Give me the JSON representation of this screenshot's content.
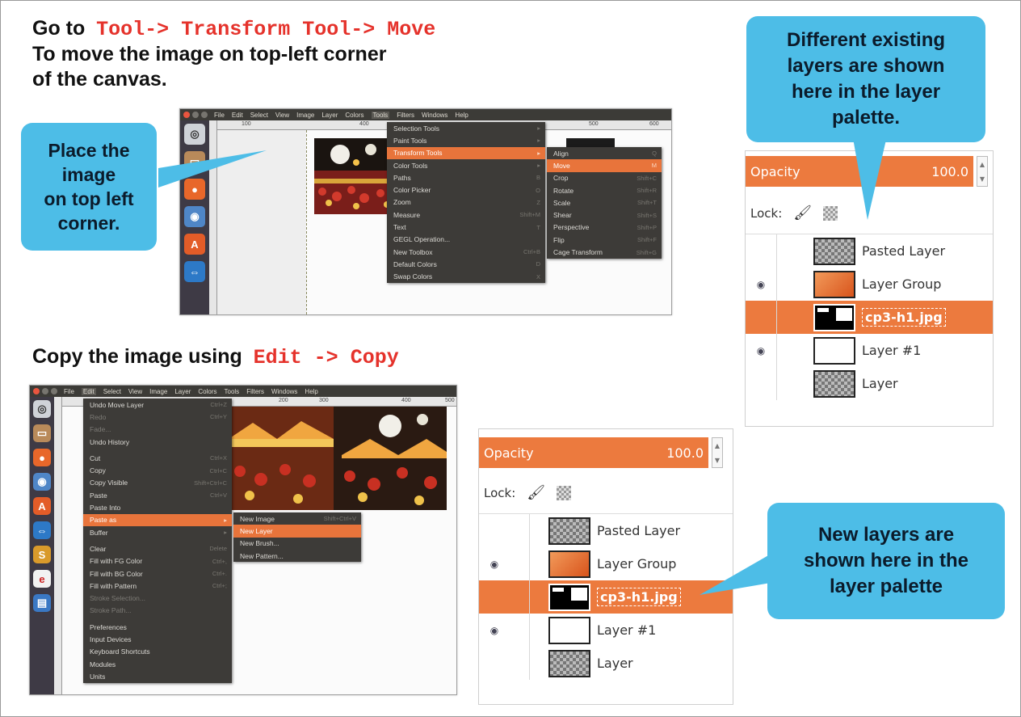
{
  "top_instruction": {
    "go_to": "Go to",
    "menu_path": "Tool-> Transform Tool-> Move",
    "line2": "To move the image on top-left corner",
    "line3": "of the canvas."
  },
  "copy_instruction": {
    "text": "Copy the image using",
    "menu_path": "Edit -> Copy"
  },
  "callouts": {
    "place": "Place the\nimage\non top left\ncorner.",
    "existing_layers": "Different existing\nlayers are shown\nhere in the layer\npalette.",
    "new_layers": "New layers are\nshown here in the\nlayer palette"
  },
  "gimp_menubar": [
    "File",
    "Edit",
    "Select",
    "View",
    "Image",
    "Layer",
    "Colors",
    "Tools",
    "Filters",
    "Windows",
    "Help"
  ],
  "ruler_top1": [
    "100",
    "400",
    "500",
    "600"
  ],
  "ruler_top2": [
    "200",
    "300",
    "400",
    "500"
  ],
  "tools_menu": [
    {
      "label": "Selection Tools",
      "sc": "▸"
    },
    {
      "label": "Paint Tools",
      "sc": "▸"
    },
    {
      "label": "Transform Tools",
      "sc": "▸",
      "sel": true
    },
    {
      "label": "Color Tools",
      "sc": "▸"
    },
    {
      "label": "Paths",
      "sc": "B"
    },
    {
      "label": "Color Picker",
      "sc": "O"
    },
    {
      "label": "Zoom",
      "sc": "Z"
    },
    {
      "label": "Measure",
      "sc": "Shift+M"
    },
    {
      "label": "Text",
      "sc": "T"
    },
    {
      "label": "GEGL Operation...",
      "sc": ""
    },
    {
      "label": "New Toolbox",
      "sc": "Ctrl+B"
    },
    {
      "label": "Default Colors",
      "sc": "D"
    },
    {
      "label": "Swap Colors",
      "sc": "X"
    }
  ],
  "transform_menu": [
    {
      "label": "Align",
      "sc": "Q"
    },
    {
      "label": "Move",
      "sc": "M",
      "sel": true
    },
    {
      "label": "Crop",
      "sc": "Shift+C"
    },
    {
      "label": "Rotate",
      "sc": "Shift+R"
    },
    {
      "label": "Scale",
      "sc": "Shift+T"
    },
    {
      "label": "Shear",
      "sc": "Shift+S"
    },
    {
      "label": "Perspective",
      "sc": "Shift+P"
    },
    {
      "label": "Flip",
      "sc": "Shift+F"
    },
    {
      "label": "Cage Transform",
      "sc": "Shift+G"
    }
  ],
  "edit_menu": [
    {
      "label": "Undo Move Layer",
      "sc": "Ctrl+Z"
    },
    {
      "label": "Redo",
      "sc": "Ctrl+Y",
      "dim": true
    },
    {
      "label": "Fade...",
      "sc": "",
      "dim": true
    },
    {
      "label": "Undo History",
      "sc": ""
    },
    {
      "sep": true
    },
    {
      "label": "Cut",
      "sc": "Ctrl+X"
    },
    {
      "label": "Copy",
      "sc": "Ctrl+C"
    },
    {
      "label": "Copy Visible",
      "sc": "Shift+Ctrl+C"
    },
    {
      "label": "Paste",
      "sc": "Ctrl+V"
    },
    {
      "label": "Paste Into",
      "sc": ""
    },
    {
      "label": "Paste as",
      "sc": "▸",
      "sel": true
    },
    {
      "label": "Buffer",
      "sc": "▸"
    },
    {
      "sep": true
    },
    {
      "label": "Clear",
      "sc": "Delete"
    },
    {
      "label": "Fill with FG Color",
      "sc": "Ctrl+,"
    },
    {
      "label": "Fill with BG Color",
      "sc": "Ctrl+."
    },
    {
      "label": "Fill with Pattern",
      "sc": "Ctrl+;"
    },
    {
      "label": "Stroke Selection...",
      "sc": "",
      "dim": true
    },
    {
      "label": "Stroke Path...",
      "sc": "",
      "dim": true
    },
    {
      "sep": true
    },
    {
      "label": "Preferences",
      "sc": ""
    },
    {
      "label": "Input Devices",
      "sc": ""
    },
    {
      "label": "Keyboard Shortcuts",
      "sc": ""
    },
    {
      "label": "Modules",
      "sc": ""
    },
    {
      "label": "Units",
      "sc": ""
    }
  ],
  "paste_as_menu": [
    {
      "label": "New Image",
      "sc": "Shift+Ctrl+V"
    },
    {
      "label": "New Layer",
      "sc": "",
      "sel": true
    },
    {
      "label": "New Brush...",
      "sc": ""
    },
    {
      "label": "New Pattern...",
      "sc": ""
    }
  ],
  "layers_panel": {
    "opacity_label": "Opacity",
    "opacity_value": "100.0",
    "lock_label": "Lock:",
    "layers": [
      {
        "name": "Pasted Layer",
        "visible": false,
        "selected": false
      },
      {
        "name": "Layer Group",
        "visible": true,
        "selected": false
      },
      {
        "name": "cp3-h1.jpg",
        "visible": false,
        "selected": true
      },
      {
        "name": "Layer #1",
        "visible": true,
        "selected": false
      },
      {
        "name": "Layer",
        "visible": false,
        "selected": false
      }
    ]
  },
  "colors": {
    "accent": "#ec7a3e",
    "callout": "#4dbde7",
    "code_red": "#e5322b",
    "menu_bg": "#3d3b38"
  }
}
